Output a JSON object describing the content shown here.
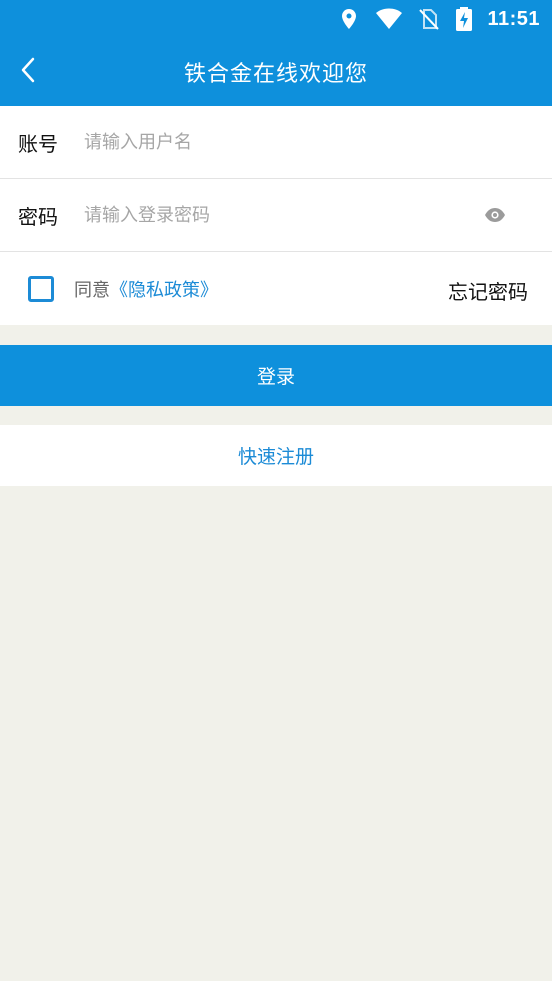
{
  "status_bar": {
    "time": "11:51",
    "icons": [
      "location-icon",
      "wifi-icon",
      "no-sim-icon",
      "battery-charging-icon"
    ]
  },
  "header": {
    "title": "铁合金在线欢迎您",
    "back_icon": "back-chevron-icon"
  },
  "form": {
    "account": {
      "label": "账号",
      "placeholder": "请输入用户名",
      "value": ""
    },
    "password": {
      "label": "密码",
      "placeholder": "请输入登录密码",
      "value": "",
      "toggle_icon": "eye-icon"
    },
    "agree": {
      "prefix": "同意",
      "link": "《隐私政策》",
      "checked": false
    },
    "forgot_label": "忘记密码"
  },
  "actions": {
    "login_label": "登录",
    "register_label": "快速注册"
  },
  "colors": {
    "primary": "#0e90dc",
    "link": "#1c8bd6",
    "background": "#f1f1ea"
  }
}
